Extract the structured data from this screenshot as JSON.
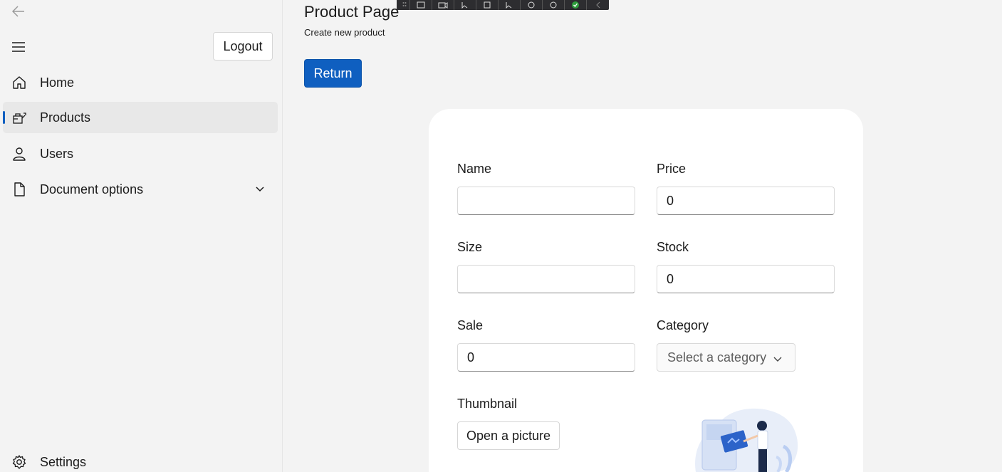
{
  "sidebar": {
    "logout_label": "Logout",
    "items": [
      {
        "label": "Home",
        "icon": "home-icon"
      },
      {
        "label": "Products",
        "icon": "products-icon",
        "selected": true
      },
      {
        "label": "Users",
        "icon": "user-icon"
      },
      {
        "label": "Document options",
        "icon": "document-icon",
        "expandable": true
      }
    ],
    "settings_label": "Settings"
  },
  "header": {
    "title": "Product Page",
    "subtitle": "Create new product",
    "return_label": "Return"
  },
  "form": {
    "name": {
      "label": "Name",
      "value": ""
    },
    "price": {
      "label": "Price",
      "value": "0"
    },
    "size": {
      "label": "Size",
      "value": ""
    },
    "stock": {
      "label": "Stock",
      "value": "0"
    },
    "sale": {
      "label": "Sale",
      "value": "0"
    },
    "category": {
      "label": "Category",
      "placeholder": "Select a category"
    },
    "thumbnail": {
      "label": "Thumbnail",
      "button_label": "Open a picture"
    }
  },
  "colors": {
    "accent": "#0f5fc0",
    "background": "#f3f3f3",
    "card": "#ffffff"
  }
}
